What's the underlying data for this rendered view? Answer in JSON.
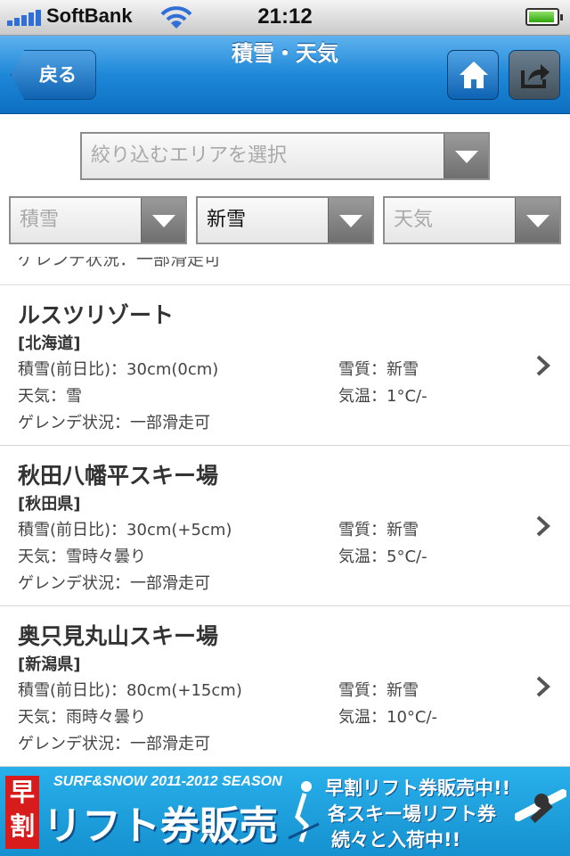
{
  "status": {
    "carrier": "SoftBank",
    "time": "21:12"
  },
  "nav": {
    "back": "戻る",
    "title": "積雪・天気"
  },
  "filters": {
    "area_placeholder": "絞り込むエリアを選択",
    "sel1": "積雪",
    "sel2": "新雪",
    "sel3": "天気"
  },
  "partial_row": "ゲレンデ状況：一部滑走可",
  "resorts": [
    {
      "name": "ルスツリゾート",
      "pref": "[北海道]",
      "snow": "積雪(前日比)：30cm(0cm)",
      "quality": "雪質：新雪",
      "weather": "天気：雪",
      "temp": "気温：1°C/-",
      "slope": "ゲレンデ状況：一部滑走可"
    },
    {
      "name": "秋田八幡平スキー場",
      "pref": "[秋田県]",
      "snow": "積雪(前日比)：30cm(+5cm)",
      "quality": "雪質：新雪",
      "weather": "天気：雪時々曇り",
      "temp": "気温：5°C/-",
      "slope": "ゲレンデ状況：一部滑走可"
    },
    {
      "name": "奥只見丸山スキー場",
      "pref": "[新潟県]",
      "snow": "積雪(前日比)：80cm(+15cm)",
      "quality": "雪質：新雪",
      "weather": "天気：雨時々曇り",
      "temp": "気温：10°C/-",
      "slope": "ゲレンデ状況：一部滑走可"
    }
  ],
  "ad": {
    "kanji1": "早",
    "kanji2": "割",
    "season": "SURF&SNOW 2011-2012 SEASON",
    "main": "リフト券販売",
    "line1": "早割リフト券販売中!!",
    "line2": "各スキー場リフト券",
    "line3": "続々と入荷中!!"
  },
  "icons": {
    "home": "home-icon",
    "share": "share-icon",
    "chevron": "chevron-right-icon",
    "wifi": "wifi-icon",
    "battery": "battery-icon"
  },
  "colors": {
    "nav": "#1e88d8",
    "ad": "#1a9fe0"
  }
}
